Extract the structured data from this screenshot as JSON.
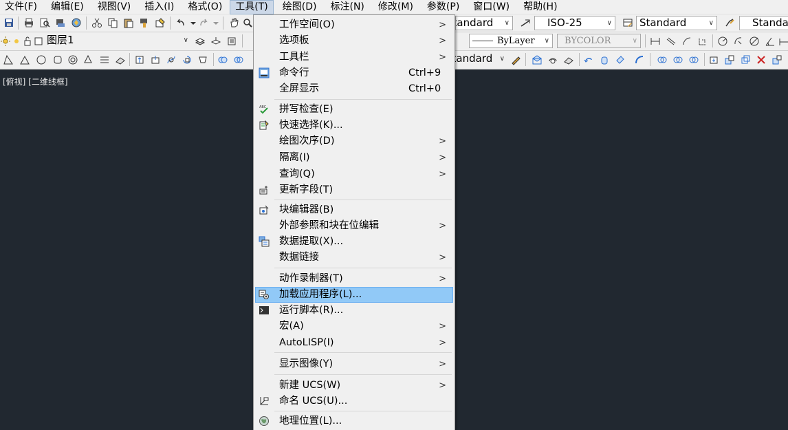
{
  "menubar": {
    "items": [
      {
        "label": "文件(F)"
      },
      {
        "label": "编辑(E)"
      },
      {
        "label": "视图(V)"
      },
      {
        "label": "插入(I)"
      },
      {
        "label": "格式(O)"
      },
      {
        "label": "工具(T)"
      },
      {
        "label": "绘图(D)"
      },
      {
        "label": "标注(N)"
      },
      {
        "label": "修改(M)"
      },
      {
        "label": "参数(P)"
      },
      {
        "label": "窗口(W)"
      },
      {
        "label": "帮助(H)"
      }
    ]
  },
  "toolbar1": {
    "textstyle_value": "Standard",
    "dimstyle_value": "ISO-25",
    "tablestyle_value": "Standard",
    "multileader_value": "Standard"
  },
  "toolbar2": {
    "layer_value": "图层1",
    "linetype_value": "ByLayer",
    "color_value": "BYCOLOR"
  },
  "toolbar3": {
    "style_value": "Standard"
  },
  "viewport": {
    "label": "[俯视] [二维线框]"
  },
  "dropdown": {
    "items": [
      {
        "label": "工作空间(O)",
        "shortcut": "",
        "submenu": true,
        "icon": ""
      },
      {
        "label": "选项板",
        "shortcut": "",
        "submenu": true,
        "icon": ""
      },
      {
        "label": "工具栏",
        "shortcut": "",
        "submenu": true,
        "icon": ""
      },
      {
        "label": "命令行",
        "shortcut": "Ctrl+9",
        "submenu": false,
        "icon": "command-line-icon"
      },
      {
        "label": "全屏显示",
        "shortcut": "Ctrl+0",
        "submenu": false,
        "icon": ""
      },
      {
        "label": "拼写检查(E)",
        "shortcut": "",
        "submenu": false,
        "icon": "spell-check-icon"
      },
      {
        "label": "快速选择(K)...",
        "shortcut": "",
        "submenu": false,
        "icon": "quick-select-icon"
      },
      {
        "label": "绘图次序(D)",
        "shortcut": "",
        "submenu": true,
        "icon": ""
      },
      {
        "label": "隔离(I)",
        "shortcut": "",
        "submenu": true,
        "icon": ""
      },
      {
        "label": "查询(Q)",
        "shortcut": "",
        "submenu": true,
        "icon": ""
      },
      {
        "label": "更新字段(T)",
        "shortcut": "",
        "submenu": false,
        "icon": "update-field-icon"
      },
      {
        "label": "块编辑器(B)",
        "shortcut": "",
        "submenu": false,
        "icon": "block-editor-icon"
      },
      {
        "label": "外部参照和块在位编辑",
        "shortcut": "",
        "submenu": true,
        "icon": ""
      },
      {
        "label": "数据提取(X)...",
        "shortcut": "",
        "submenu": false,
        "icon": "data-extraction-icon"
      },
      {
        "label": "数据链接",
        "shortcut": "",
        "submenu": true,
        "icon": ""
      },
      {
        "label": "动作录制器(T)",
        "shortcut": "",
        "submenu": true,
        "icon": ""
      },
      {
        "label": "加载应用程序(L)...",
        "shortcut": "",
        "submenu": false,
        "icon": "load-application-icon"
      },
      {
        "label": "运行脚本(R)...",
        "shortcut": "",
        "submenu": false,
        "icon": "run-script-icon"
      },
      {
        "label": "宏(A)",
        "shortcut": "",
        "submenu": true,
        "icon": ""
      },
      {
        "label": "AutoLISP(I)",
        "shortcut": "",
        "submenu": true,
        "icon": ""
      },
      {
        "label": "显示图像(Y)",
        "shortcut": "",
        "submenu": true,
        "icon": ""
      },
      {
        "label": "新建 UCS(W)",
        "shortcut": "",
        "submenu": true,
        "icon": ""
      },
      {
        "label": "命名 UCS(U)...",
        "shortcut": "",
        "submenu": false,
        "icon": "named-ucs-icon"
      },
      {
        "label": "地理位置(L)...",
        "shortcut": "",
        "submenu": false,
        "icon": "geographic-location-icon"
      }
    ]
  }
}
